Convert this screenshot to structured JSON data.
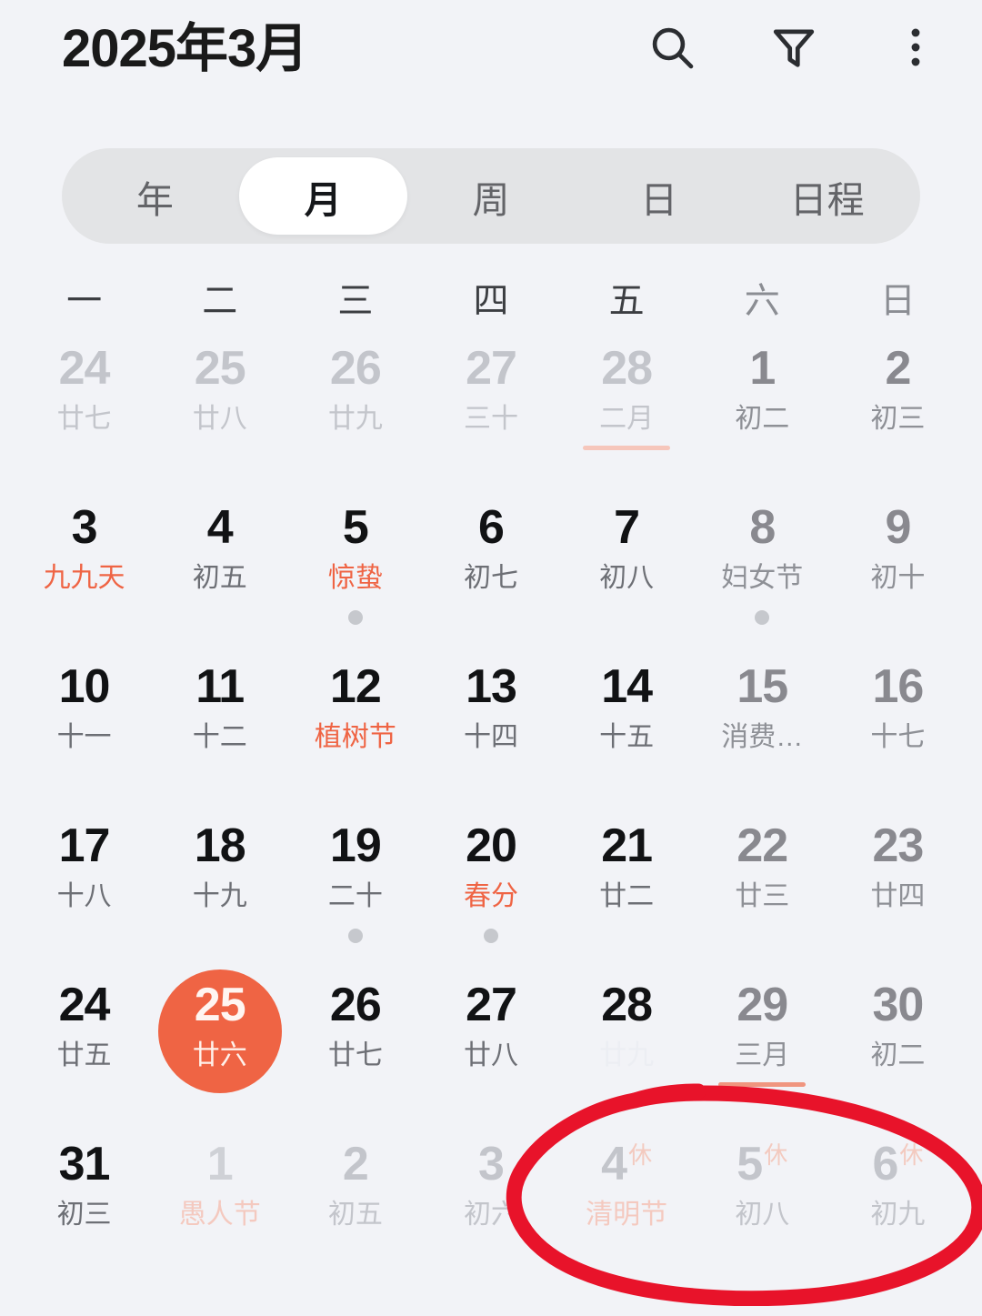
{
  "header": {
    "title": "2025年3月",
    "icons": [
      {
        "name": "search-icon",
        "label": "搜索"
      },
      {
        "name": "filter-icon",
        "label": "筛选"
      },
      {
        "name": "more-options-icon",
        "label": "更多"
      }
    ]
  },
  "view_tabs": {
    "active": "月",
    "items": [
      {
        "label": "年"
      },
      {
        "label": "月"
      },
      {
        "label": "周"
      },
      {
        "label": "日"
      },
      {
        "label": "日程"
      }
    ]
  },
  "weekdays": [
    {
      "label": "一",
      "weekend": false
    },
    {
      "label": "二",
      "weekend": false
    },
    {
      "label": "三",
      "weekend": false
    },
    {
      "label": "四",
      "weekend": false
    },
    {
      "label": "五",
      "weekend": false
    },
    {
      "label": "六",
      "weekend": true
    },
    {
      "label": "日",
      "weekend": true
    }
  ],
  "colors": {
    "background": "#f2f3f7",
    "accent_orange": "#ef6444",
    "annotation_red": "#e8132a",
    "tab_track": "#e3e4e6",
    "text_primary": "#111214",
    "text_muted": "#6d6f75",
    "out_of_month": "#c3c5cb"
  },
  "calendar": {
    "month_label": "2025年3月",
    "selected_day": 25,
    "weeks": [
      [
        {
          "day": "24",
          "lunar": "廿七",
          "out": true
        },
        {
          "day": "25",
          "lunar": "廿八",
          "out": true
        },
        {
          "day": "26",
          "lunar": "廿九",
          "out": true
        },
        {
          "day": "27",
          "lunar": "三十",
          "out": true
        },
        {
          "day": "28",
          "lunar": "二月",
          "out": true,
          "month_marker": true
        },
        {
          "day": "1",
          "lunar": "初二",
          "weekend": true
        },
        {
          "day": "2",
          "lunar": "初三",
          "weekend": true
        }
      ],
      [
        {
          "day": "3",
          "lunar": "九九天",
          "festival": true
        },
        {
          "day": "4",
          "lunar": "初五"
        },
        {
          "day": "5",
          "lunar": "惊蛰",
          "festival": true,
          "dot": true
        },
        {
          "day": "6",
          "lunar": "初七"
        },
        {
          "day": "7",
          "lunar": "初八"
        },
        {
          "day": "8",
          "lunar": "妇女节",
          "festival": true,
          "weekend": true,
          "dot": true
        },
        {
          "day": "9",
          "lunar": "初十",
          "weekend": true
        }
      ],
      [
        {
          "day": "10",
          "lunar": "十一"
        },
        {
          "day": "11",
          "lunar": "十二"
        },
        {
          "day": "12",
          "lunar": "植树节",
          "festival": true
        },
        {
          "day": "13",
          "lunar": "十四"
        },
        {
          "day": "14",
          "lunar": "十五"
        },
        {
          "day": "15",
          "lunar": "消费…",
          "festival": true,
          "weekend": true
        },
        {
          "day": "16",
          "lunar": "十七",
          "weekend": true
        }
      ],
      [
        {
          "day": "17",
          "lunar": "十八"
        },
        {
          "day": "18",
          "lunar": "十九"
        },
        {
          "day": "19",
          "lunar": "二十",
          "dot": true
        },
        {
          "day": "20",
          "lunar": "春分",
          "festival": true,
          "dot": true
        },
        {
          "day": "21",
          "lunar": "廿二"
        },
        {
          "day": "22",
          "lunar": "廿三",
          "weekend": true
        },
        {
          "day": "23",
          "lunar": "廿四",
          "weekend": true
        }
      ],
      [
        {
          "day": "24",
          "lunar": "廿五"
        },
        {
          "day": "25",
          "lunar": "廿六",
          "today": true
        },
        {
          "day": "26",
          "lunar": "廿七"
        },
        {
          "day": "27",
          "lunar": "廿八"
        },
        {
          "day": "28",
          "lunar": "廿九",
          "ghost": true
        },
        {
          "day": "29",
          "lunar": "三月",
          "weekend": true,
          "month_marker": true,
          "month_marker_strong": true
        },
        {
          "day": "30",
          "lunar": "初二",
          "weekend": true
        }
      ],
      [
        {
          "day": "31",
          "lunar": "初三"
        },
        {
          "day": "1",
          "lunar": "愚人节",
          "out": true,
          "faded": true,
          "festival": true
        },
        {
          "day": "2",
          "lunar": "初五",
          "out": true
        },
        {
          "day": "3",
          "lunar": "初六",
          "out": true
        },
        {
          "day": "4",
          "lunar": "清明节",
          "out": true,
          "festival": true,
          "rest": "休"
        },
        {
          "day": "5",
          "lunar": "初八",
          "out": true,
          "rest": "休"
        },
        {
          "day": "6",
          "lunar": "初九",
          "out": true,
          "rest": "休"
        }
      ]
    ]
  },
  "annotation": {
    "type": "hand-drawn-ellipse",
    "color": "#e8132a",
    "encircles": [
      "4 清明节",
      "5 初八",
      "6 初九"
    ]
  }
}
